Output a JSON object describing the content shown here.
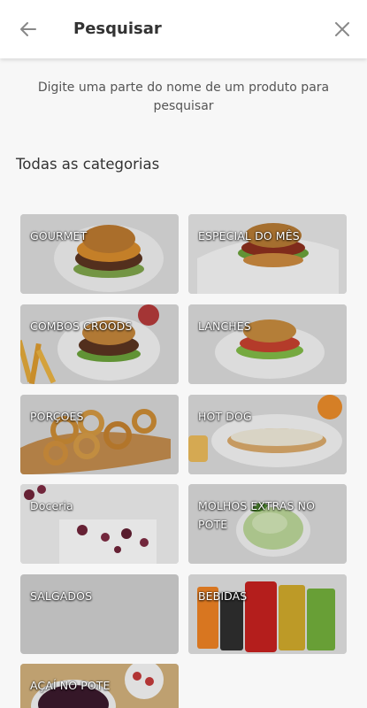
{
  "header": {
    "title": "Pesquisar"
  },
  "search_hint": "Digite uma parte do nome de um produto para pesquisar",
  "categories_title": "Todas as categorias",
  "categories": [
    {
      "label": "GOURMET",
      "icon": "burger-image"
    },
    {
      "label": "ESPECIAL DO MÊS",
      "icon": "burger-image"
    },
    {
      "label": "COMBOS CROODS",
      "icon": "combo-image"
    },
    {
      "label": "LANCHES",
      "icon": "burger-image"
    },
    {
      "label": "PORÇOES",
      "icon": "onion-rings-image"
    },
    {
      "label": "HOT DOG",
      "icon": "hot-dog-image"
    },
    {
      "label": "Doceria",
      "icon": "dessert-image"
    },
    {
      "label": "MOLHOS EXTRAS NO POTE",
      "icon": "sauce-image"
    },
    {
      "label": "SALGADOS",
      "icon": "placeholder"
    },
    {
      "label": "BEBIDAS",
      "icon": "soda-cans-image"
    },
    {
      "label": "AÇAÍ NO POTE",
      "icon": "acai-image"
    }
  ],
  "colors": {
    "background": "#f7f7f7",
    "header": "#ffffff",
    "tile_placeholder": "#c8c8c8"
  }
}
